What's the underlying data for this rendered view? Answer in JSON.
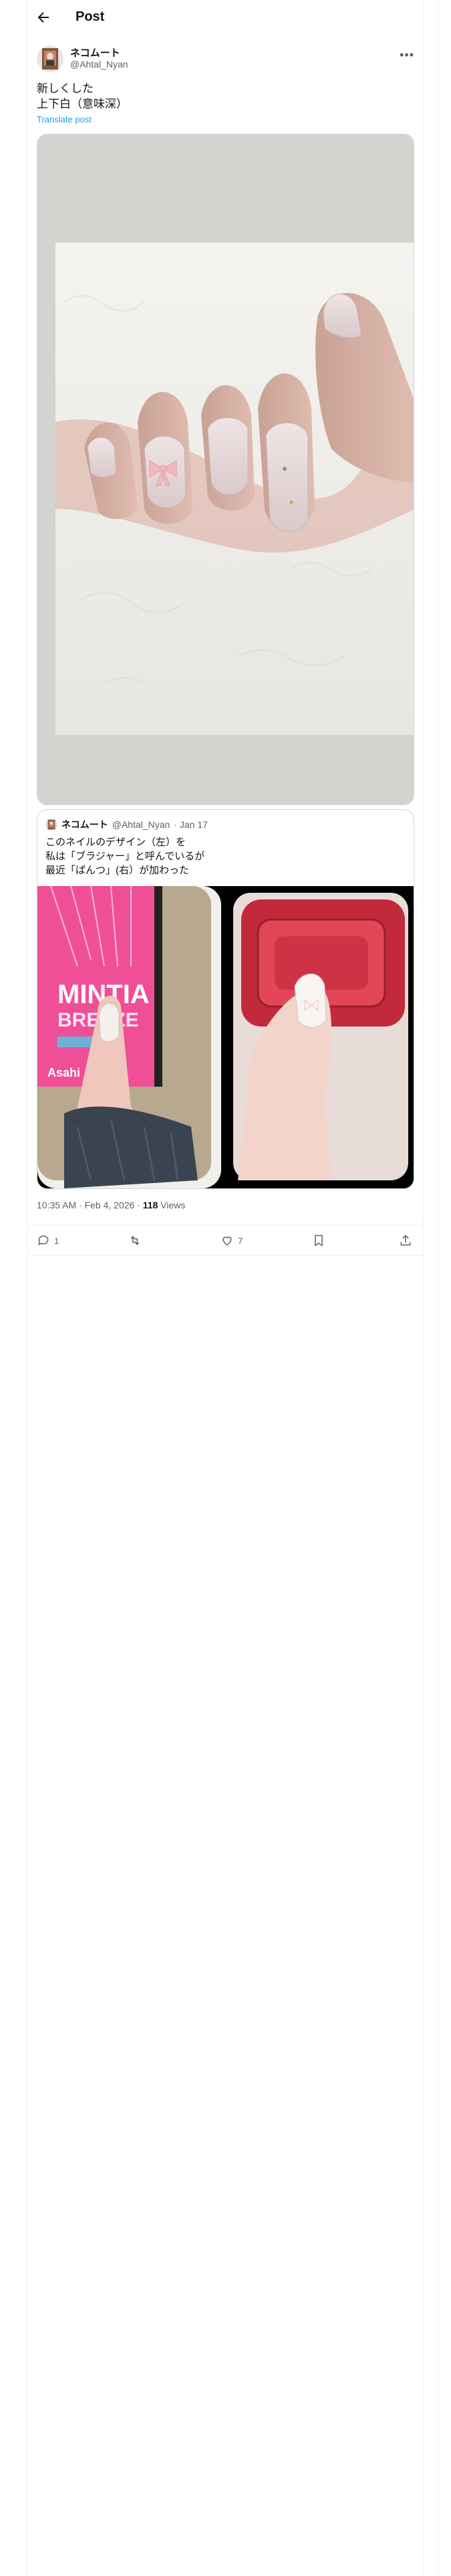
{
  "header": {
    "title": "Post"
  },
  "post": {
    "author_name": "ネコムート",
    "author_handle": "@Ahtal_Nyan",
    "text_lines": [
      "新しくした",
      "上下白（意味深）"
    ],
    "translate_label": "Translate post",
    "timestamp": "10:35 AM · Feb 4, 2026 · ",
    "views_count": "118",
    "views_label": " Views"
  },
  "quote": {
    "author_name": "ネコムート",
    "author_handle": "@Ahtal_Nyan",
    "date": " · Jan 17",
    "text_lines": [
      "このネイルのデザイン（左）を",
      "私は「ブラジャー」と呼んでいるが",
      "最近「ぱんつ」(右）が加わった"
    ],
    "product_text": "MINTIA",
    "product_sub": "BREEZE",
    "brand": "Asahi"
  },
  "actions": {
    "reply_count": "1",
    "retweet_count": "",
    "like_count": "7"
  }
}
